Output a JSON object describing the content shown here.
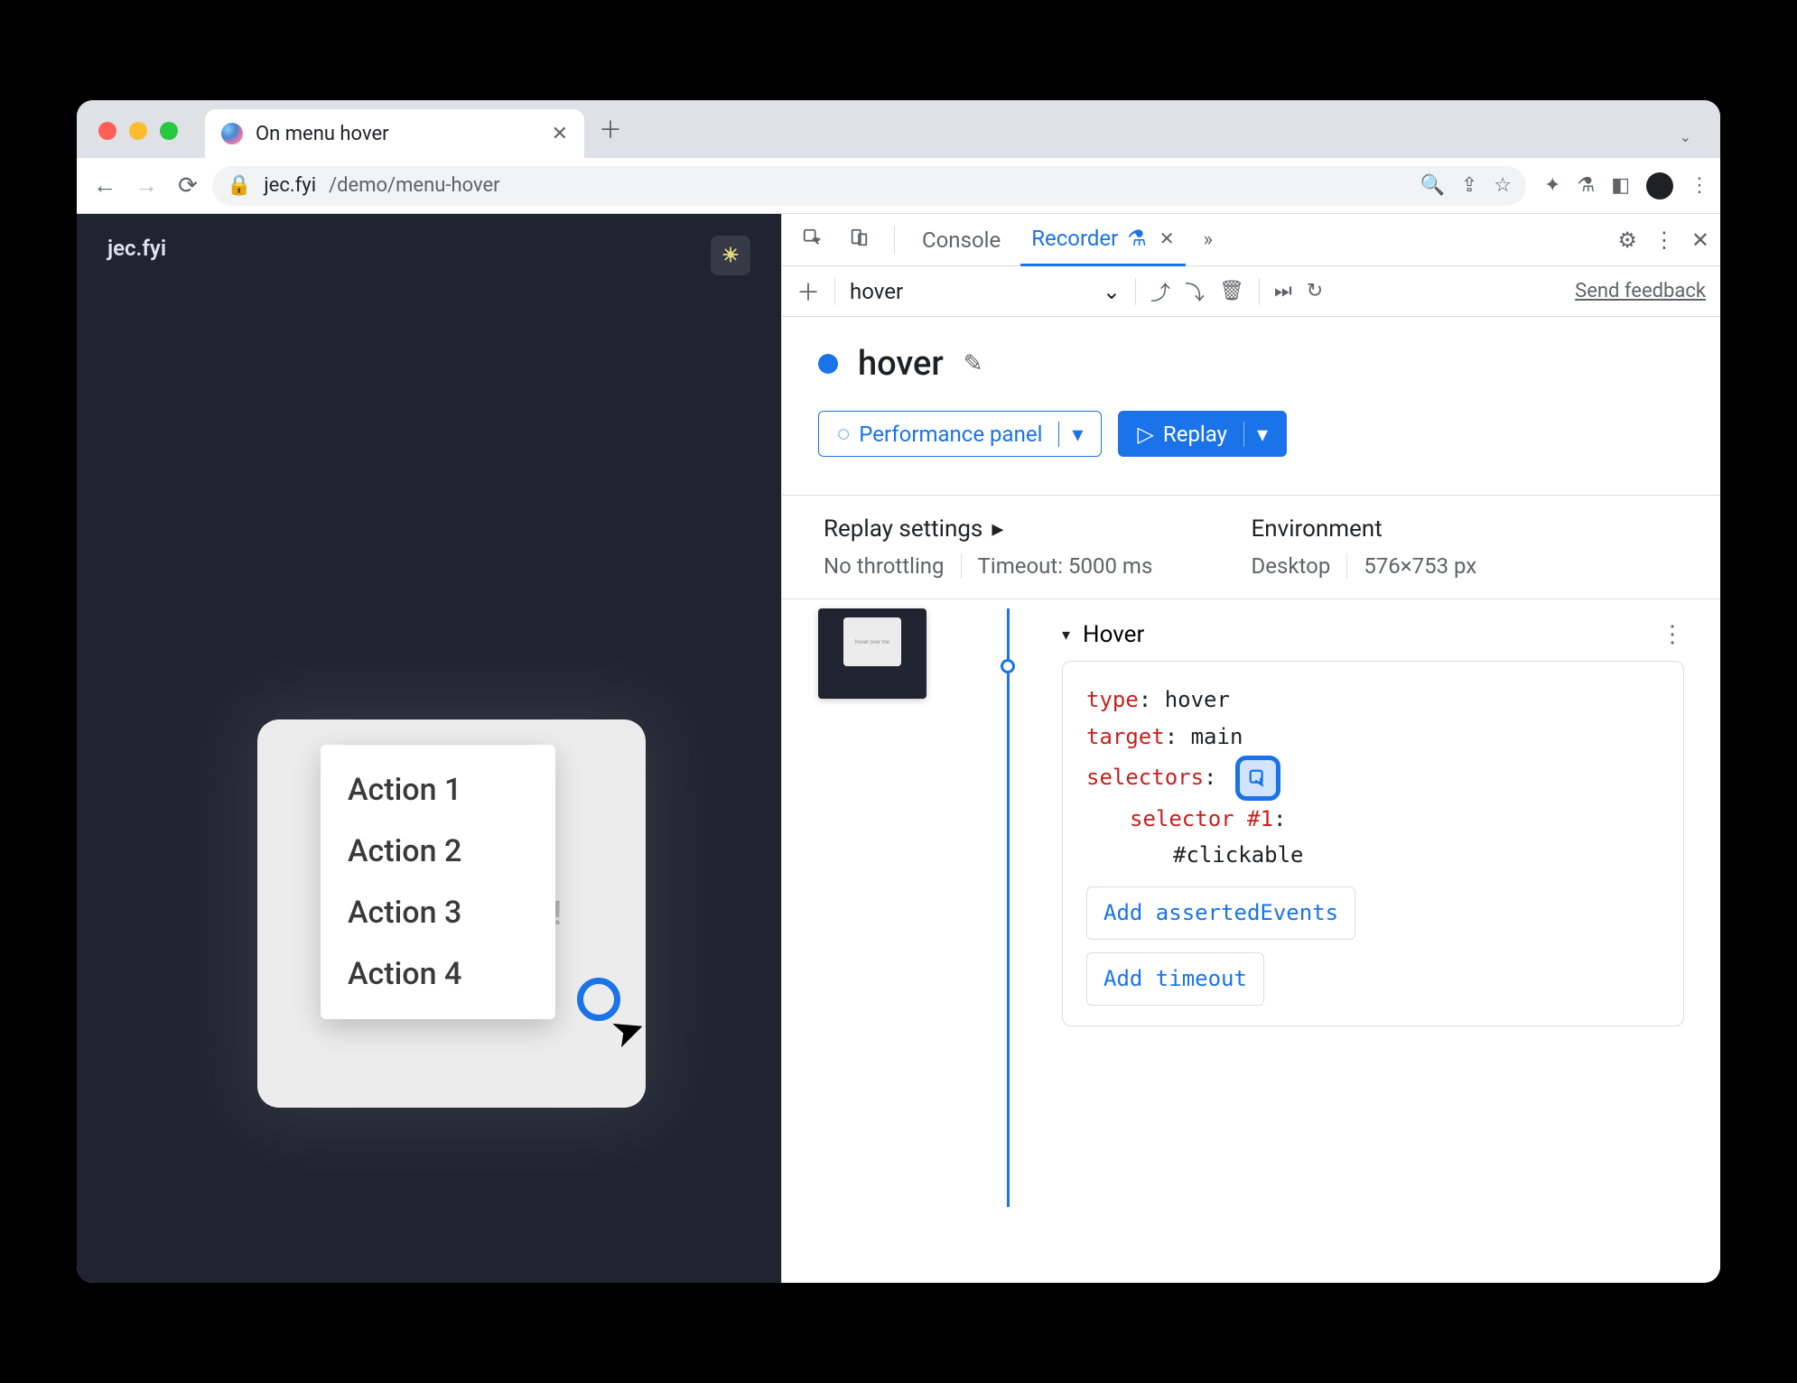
{
  "browser": {
    "tab_title": "On menu hover",
    "url_host": "jec.fyi",
    "url_path": "/demo/menu-hover"
  },
  "page": {
    "brand": "jec.fyi",
    "card_text": "Hover over me!",
    "menu_items": [
      "Action 1",
      "Action 2",
      "Action 3",
      "Action 4"
    ]
  },
  "devtools": {
    "tabs": {
      "console": "Console",
      "recorder": "Recorder"
    },
    "recorder": {
      "select_value": "hover",
      "feedback": "Send feedback",
      "title": "hover",
      "perf_btn": "Performance panel",
      "replay_btn": "Replay",
      "replay_settings_hdr": "Replay settings",
      "environment_hdr": "Environment",
      "throttling": "No throttling",
      "timeout": "Timeout: 5000 ms",
      "env_device": "Desktop",
      "env_size": "576×753 px",
      "step_name": "Hover",
      "details": {
        "type_k": "type",
        "type_v": "hover",
        "target_k": "target",
        "target_v": "main",
        "selectors_k": "selectors",
        "sel1_label": "selector #1",
        "sel1_value": "#clickable",
        "add_asserted": "Add assertedEvents",
        "add_timeout": "Add timeout"
      }
    }
  }
}
